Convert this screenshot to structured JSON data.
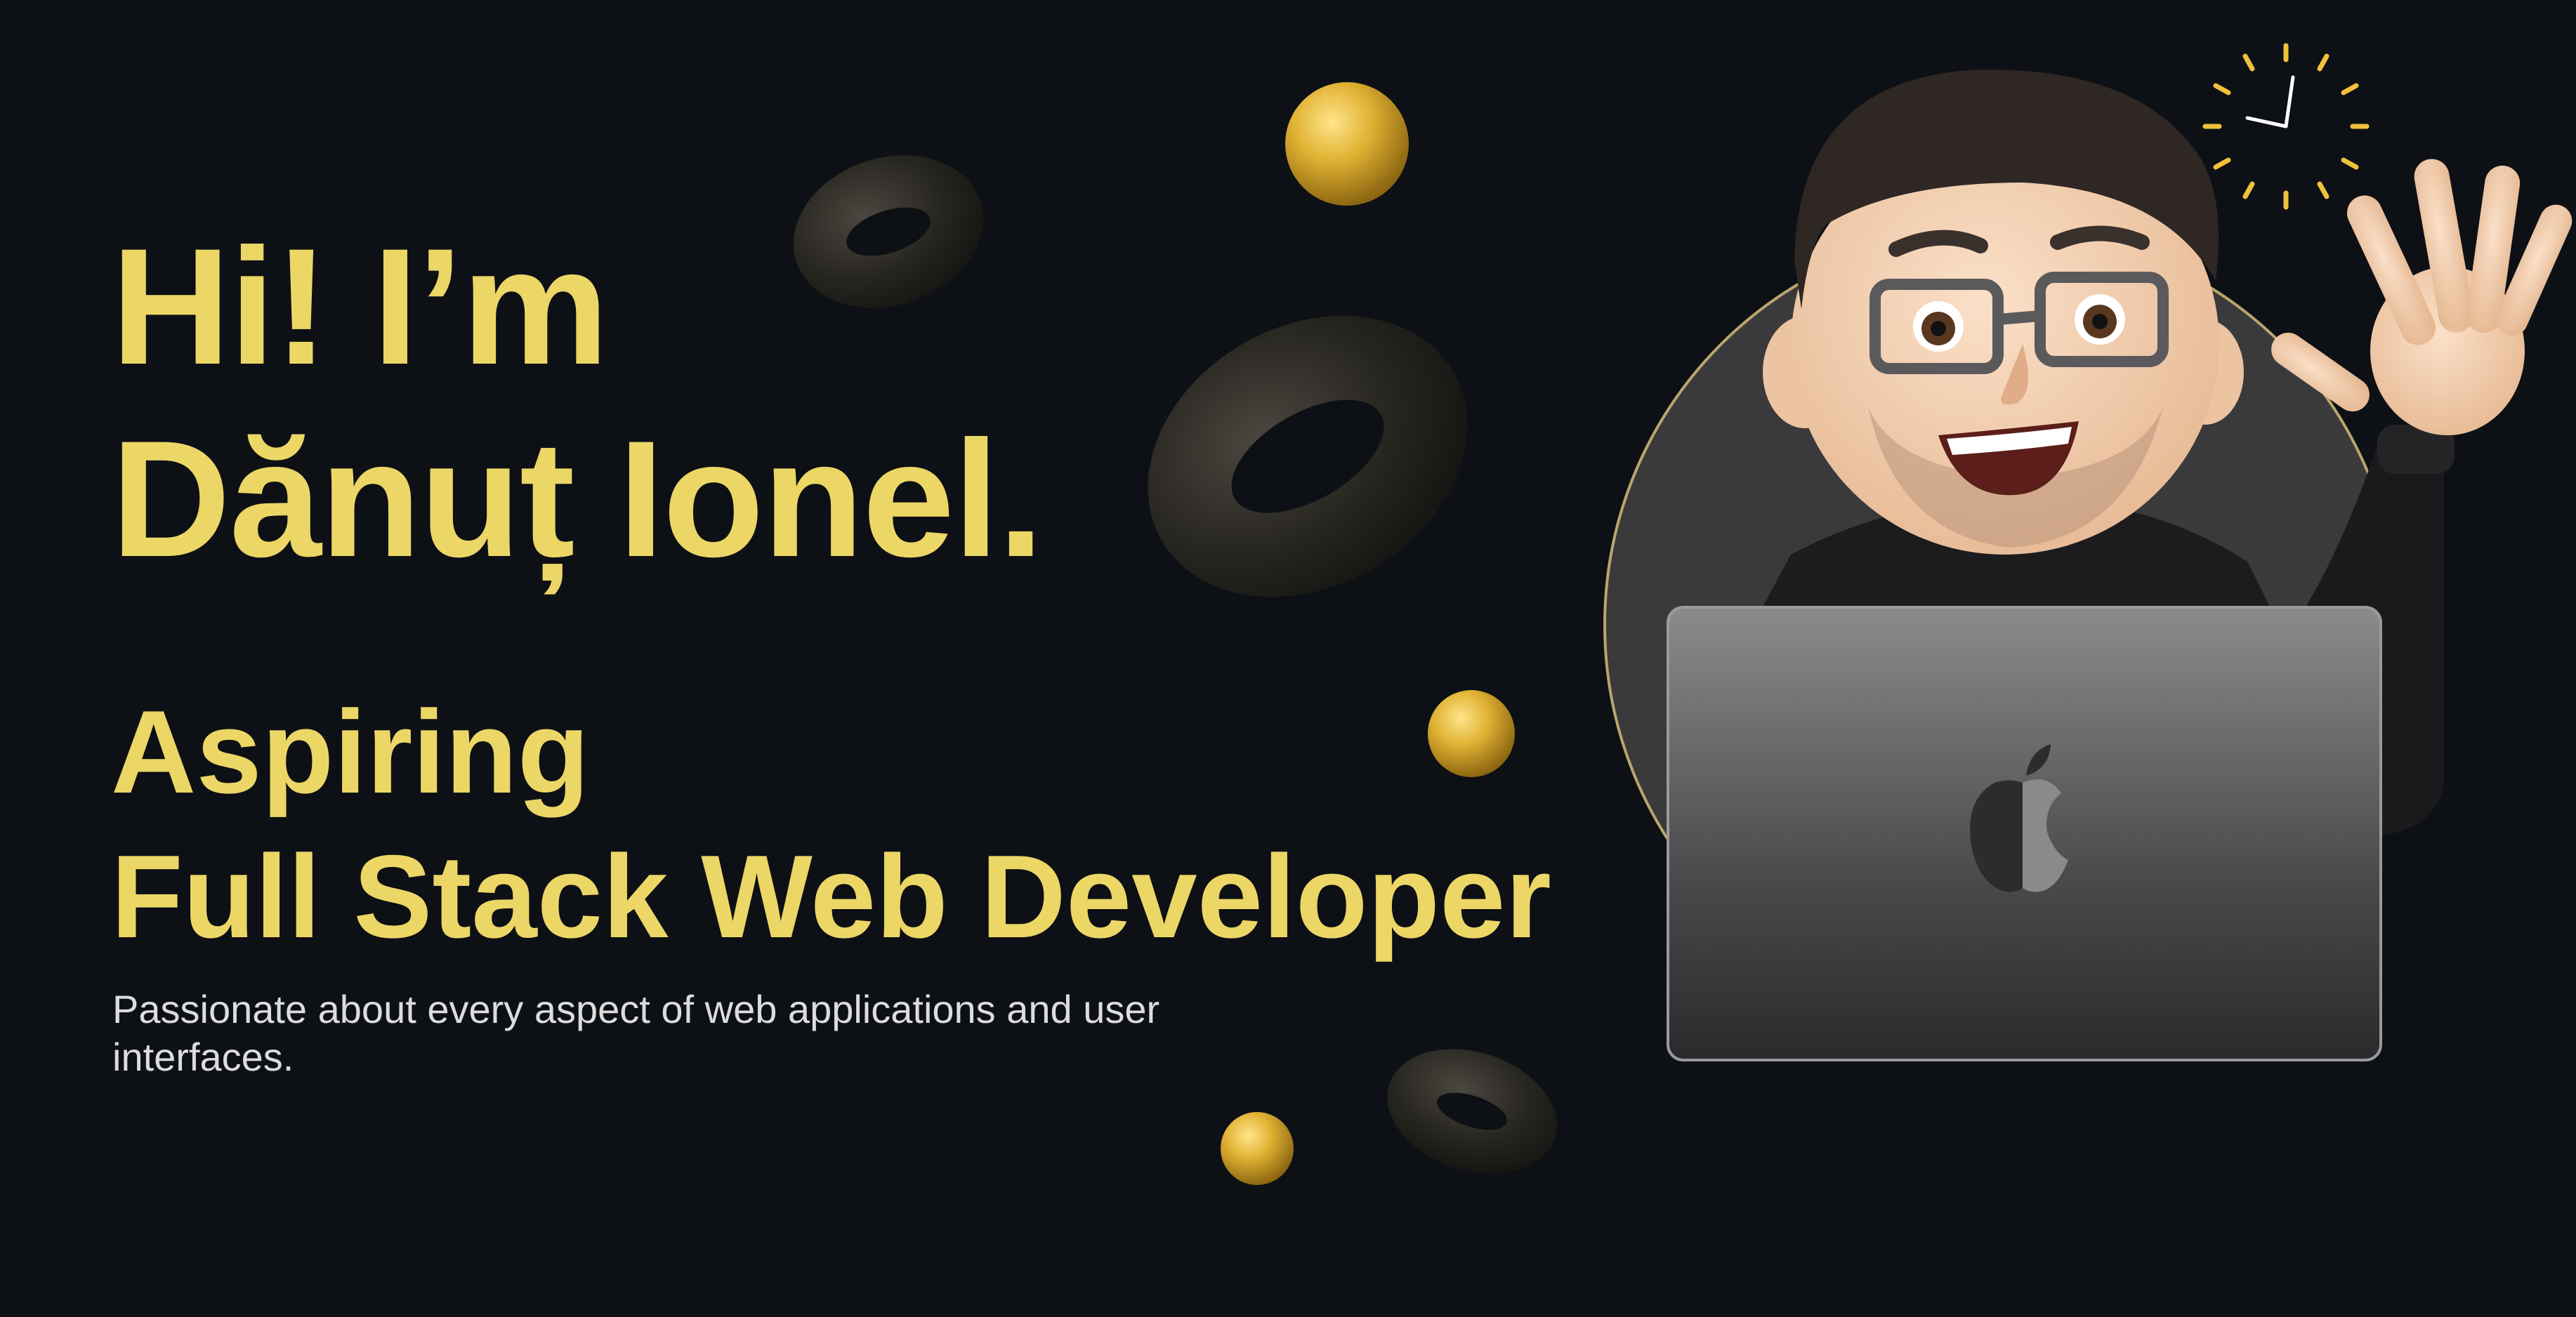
{
  "hero": {
    "greeting_line1": "Hi! I’m",
    "greeting_line2": "Dănuț Ionel.",
    "role_line1": "Aspiring",
    "role_line2": "Full Stack Web Developer",
    "tagline": "Passionate about every aspect of web applications and user interfaces."
  },
  "colors": {
    "background": "#0d1015",
    "accent": "#ecd666",
    "text_secondary": "#dcdcdc",
    "sphere": "#d9a926",
    "torus": "#26241f"
  },
  "icons": {
    "avatar": "memoji-avatar-with-laptop",
    "laptop_logo": "apple-logo-icon",
    "clock": "clock-icon"
  }
}
